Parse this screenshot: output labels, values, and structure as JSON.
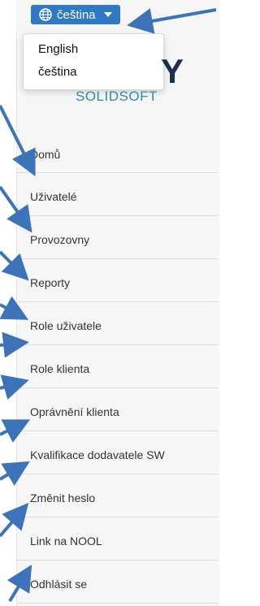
{
  "language": {
    "current": "čeština",
    "options": [
      "English",
      "čeština"
    ]
  },
  "logo": {
    "letter": "Y",
    "subtitle": "SOLIDSOFT"
  },
  "menu": {
    "items": [
      {
        "label": "Domů"
      },
      {
        "label": "Uživatelé"
      },
      {
        "label": "Provozovny"
      },
      {
        "label": "Reporty"
      },
      {
        "label": "Role uživatele"
      },
      {
        "label": "Role klienta"
      },
      {
        "label": "Oprávnění klienta"
      },
      {
        "label": "Kvalifikace dodavatele SW"
      },
      {
        "label": "Změnit heslo"
      },
      {
        "label": "Link na NOOL"
      },
      {
        "label": "Odhlásit se"
      }
    ]
  },
  "colors": {
    "accent": "#2f78c4",
    "arrow": "#3d73b8"
  }
}
